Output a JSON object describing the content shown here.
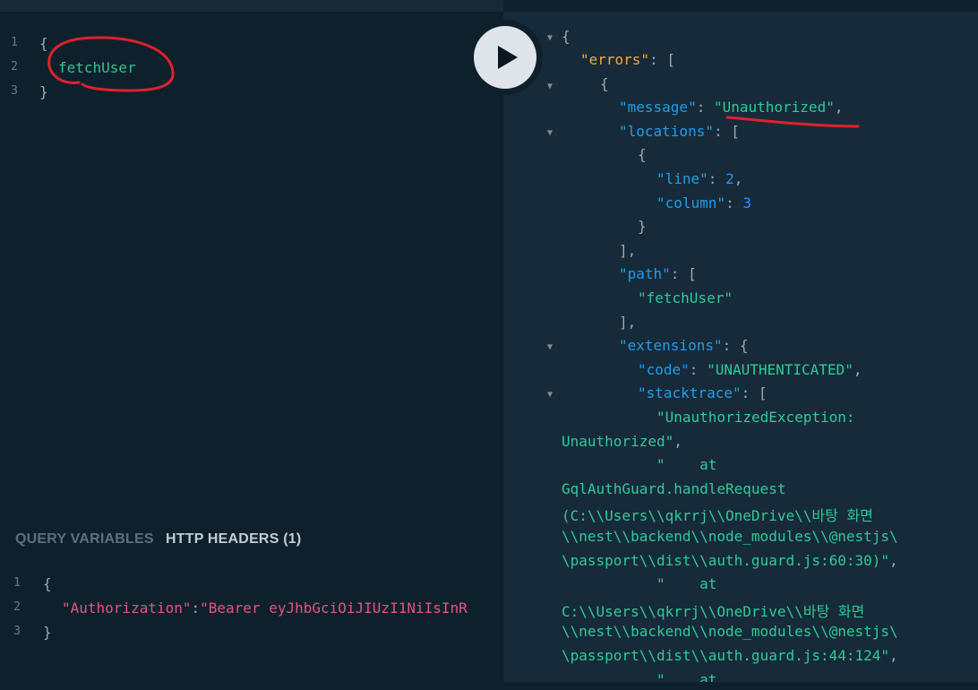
{
  "query_editor": {
    "line_numbers": [
      "1",
      "2",
      "3"
    ],
    "lines": [
      "{",
      "fetchUser",
      "}"
    ]
  },
  "run_button": {
    "icon": "play-icon"
  },
  "bottom_panel": {
    "tabs": [
      {
        "label": "QUERY VARIABLES",
        "active": false
      },
      {
        "label": "HTTP HEADERS (1)",
        "active": true
      }
    ],
    "line_numbers": [
      "1",
      "2",
      "3"
    ],
    "open_brace": "{",
    "header_key": "\"Authorization\"",
    "colon": ":",
    "header_value": "\"Bearer eyJhbGciOiJIUzI1NiIsInR",
    "close_brace": "}"
  },
  "result": {
    "fold_icon": "triangle-down-icon",
    "lines": {
      "l01": "{",
      "l02_key": "\"errors\"",
      "l02_rest": ": [",
      "l03": "{",
      "l04_key": "\"message\"",
      "l04_colon": ": ",
      "l04_val": "\"Unauthorized\"",
      "l04_comma": ",",
      "l05_key": "\"locations\"",
      "l05_rest": ": [",
      "l06": "{",
      "l07_key": "\"line\"",
      "l07_colon": ": ",
      "l07_val": "2",
      "l07_comma": ",",
      "l08_key": "\"column\"",
      "l08_colon": ": ",
      "l08_val": "3",
      "l09": "}",
      "l10": "],",
      "l11_key": "\"path\"",
      "l11_rest": ": [",
      "l12": "\"fetchUser\"",
      "l13": "],",
      "l14_key": "\"extensions\"",
      "l14_rest": ": {",
      "l15_key": "\"code\"",
      "l15_colon": ": ",
      "l15_val": "\"UNAUTHENTICATED\"",
      "l15_comma": ",",
      "l16_key": "\"stacktrace\"",
      "l16_rest": ": [",
      "l17": "\"UnauthorizedException:",
      "l18_val": "Unauthorized\"",
      "l18_comma": ",",
      "l19": "\"    at",
      "l20": "GqlAuthGuard.handleRequest",
      "l21": "(C:\\\\Users\\\\qkrrj\\\\OneDrive\\\\바탕 화면",
      "l22": "\\\\nest\\\\backend\\\\node_modules\\\\@nestjs\\",
      "l23_val": "\\passport\\\\dist\\\\auth.guard.js:60:30)\"",
      "l23_comma": ",",
      "l24": "\"    at",
      "l25": "C:\\\\Users\\\\qkrrj\\\\OneDrive\\\\바탕 화면",
      "l26": "\\\\nest\\\\backend\\\\node_modules\\\\@nestjs\\",
      "l27_val": "\\passport\\\\dist\\\\auth.guard.js:44:124\"",
      "l27_comma": ",",
      "l28": "\"    at"
    }
  },
  "colors": {
    "editor_bg": "#0f202d",
    "result_bg": "#172a3a",
    "field": "#37c18d",
    "property": "#1f9fe7",
    "string": "#2ecb97",
    "number": "#2c91ff",
    "errors_key": "#f4a93c",
    "header_key": "#e35480",
    "annotation": "#e0212b"
  }
}
